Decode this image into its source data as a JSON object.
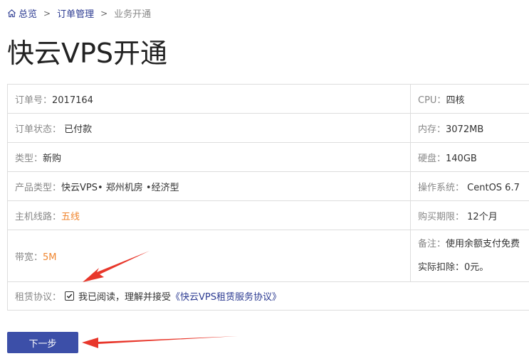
{
  "breadcrumb": {
    "home": "总览",
    "orders": "订单管理",
    "current": "业务开通",
    "separator": ">"
  },
  "page_title": "快云VPS开通",
  "order": {
    "number_label": "订单号：",
    "number_value": "2017164",
    "status_label": "订单状态：",
    "status_value": "已付款",
    "type_label": "类型：",
    "type_value": "新购",
    "product_label": "产品类型：",
    "product_value": "快云VPS• 郑州机房 •经济型",
    "line_label": "主机线路：",
    "line_value": "五线",
    "bandwidth_label": "带宽：",
    "bandwidth_value": "5M",
    "agreement_label": "租赁协议：",
    "agreement_text": "我已阅读，理解并接受",
    "agreement_link": "《快云VPS租赁服务协议》",
    "agreement_checked": true
  },
  "specs": {
    "cpu_label": "CPU：",
    "cpu_value": "四核",
    "memory_label": "内存：",
    "memory_value": "3072MB",
    "disk_label": "硬盘：",
    "disk_value": "140GB",
    "os_label": "操作系统：",
    "os_value": "CentOS 6.7",
    "period_label": "购买期限：",
    "period_value": "12个月",
    "note_label": "备注：",
    "note_value": "使用余额支付免费",
    "deduct_label": "实际扣除：",
    "deduct_value": "0元。"
  },
  "next_button": "下一步",
  "colors": {
    "link": "#2b3a91",
    "button": "#3c4fa8",
    "orange": "#f0862f",
    "arrow": "#e8372b"
  }
}
